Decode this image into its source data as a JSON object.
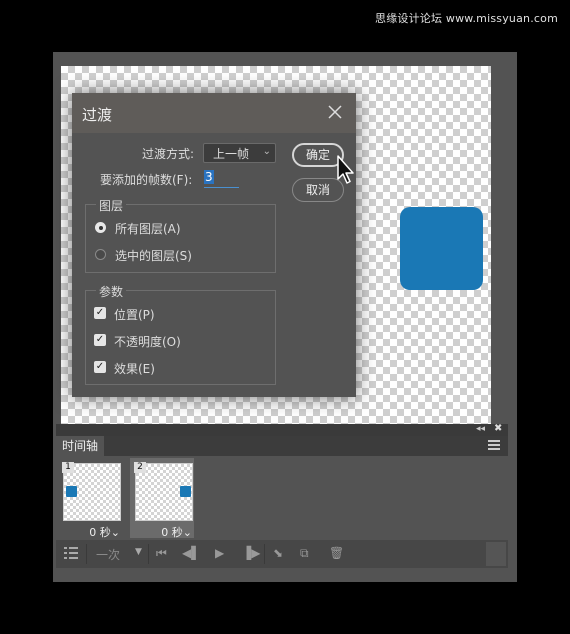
{
  "watermark": "思缘设计论坛 www.missyuan.com",
  "dialog": {
    "title": "过渡",
    "close_icon": "close-icon",
    "tween_with_label": "过渡方式:",
    "tween_with_value": "上一帧",
    "frames_label": "要添加的帧数(F):",
    "frames_value": "3",
    "layers_group": {
      "title": "图层",
      "options": [
        "所有图层(A)",
        "选中的图层(S)"
      ],
      "selected": "所有图层(A)"
    },
    "params_group": {
      "title": "参数",
      "options": [
        "位置(P)",
        "不透明度(O)",
        "效果(E)"
      ],
      "checked": [
        true,
        true,
        true
      ]
    },
    "ok_label": "确定",
    "cancel_label": "取消"
  },
  "timeline": {
    "tab_label": "时间轴",
    "frames": [
      {
        "number": "1",
        "delay": "0 秒",
        "selected": false
      },
      {
        "number": "2",
        "delay": "0 秒",
        "selected": true
      }
    ],
    "loop_value": "一次"
  },
  "colors": {
    "shape": "#1a78b5",
    "panel": "#535353",
    "background": "#000000"
  }
}
